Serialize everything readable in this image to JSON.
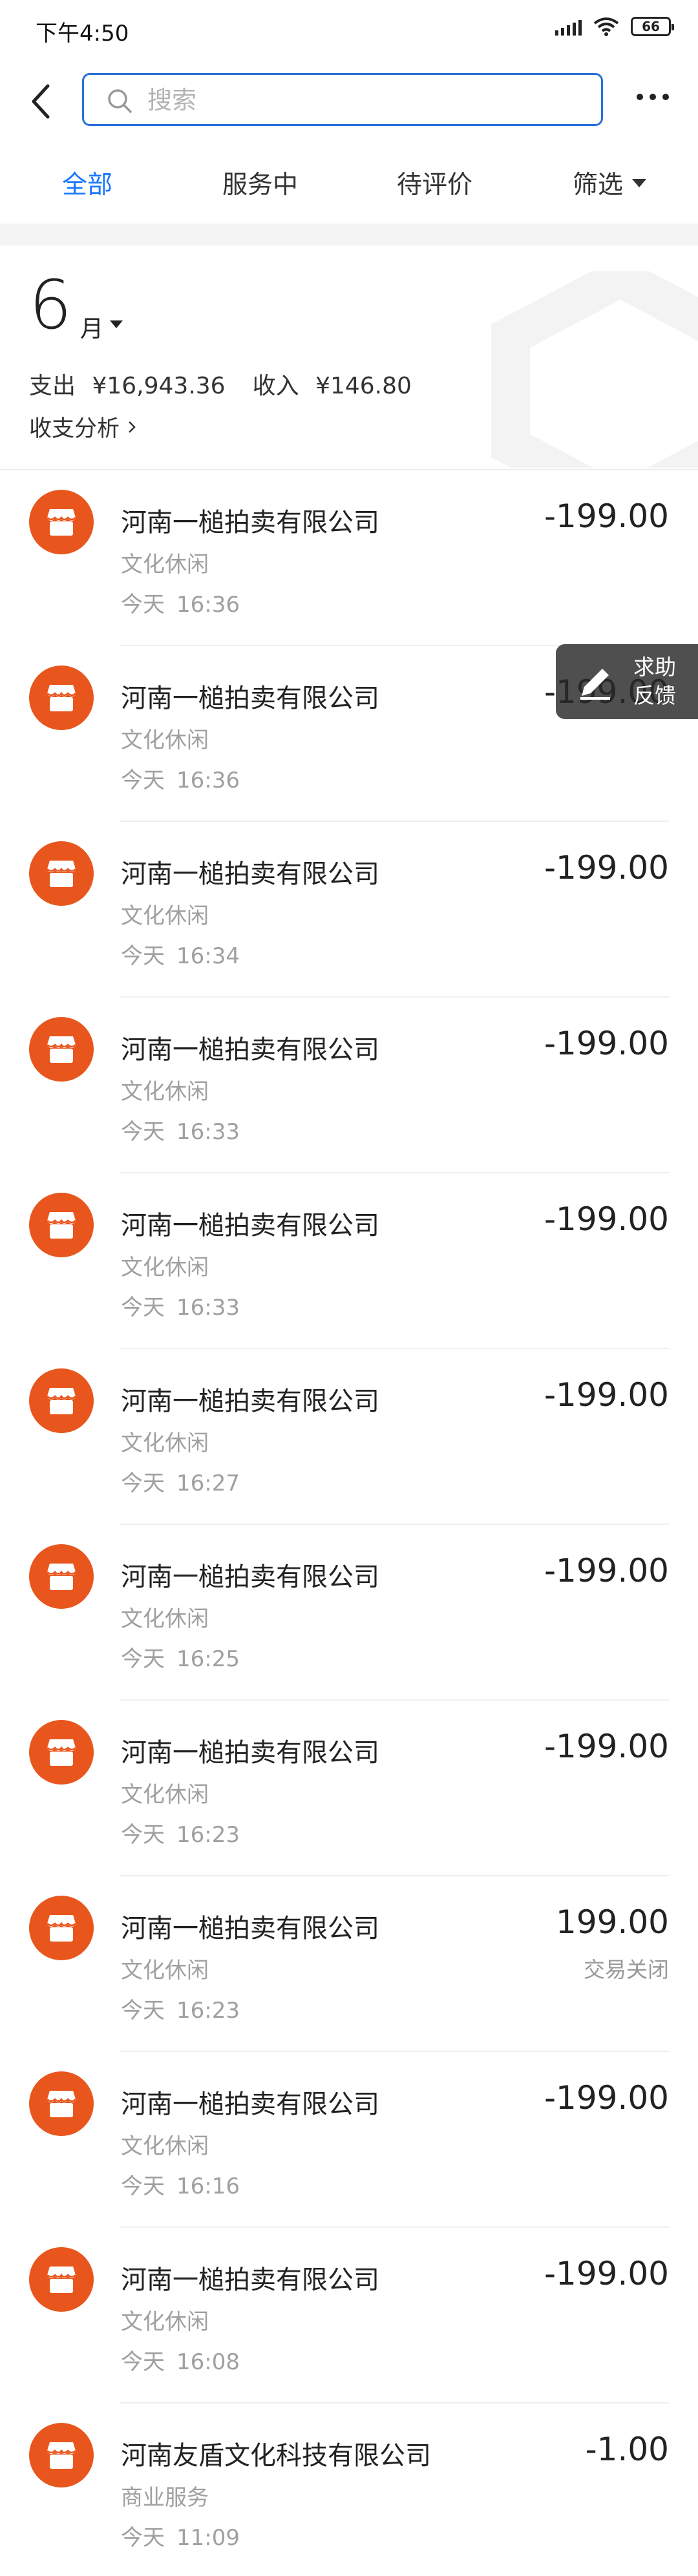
{
  "status_bar": {
    "time": "下午4:50",
    "battery": "66"
  },
  "header": {
    "search_placeholder": "搜索",
    "back_icon": "chevron-left-icon",
    "more_icon": "more-dots-icon"
  },
  "tabs": [
    {
      "label": "全部",
      "active": true
    },
    {
      "label": "服务中",
      "active": false
    },
    {
      "label": "待评价",
      "active": false
    },
    {
      "label": "筛选",
      "active": false
    }
  ],
  "summary": {
    "month": "6",
    "month_unit": "月",
    "expense_label": "支出",
    "expense": "¥16,943.36",
    "income_label": "收入",
    "income": "¥146.80",
    "analysis_label": "收支分析"
  },
  "transactions": [
    {
      "merchant": "河南一槌拍卖有限公司",
      "category": "文化休闲",
      "day": "今天",
      "time": "16:36",
      "amount": "-199.00",
      "note": ""
    },
    {
      "merchant": "河南一槌拍卖有限公司",
      "category": "文化休闲",
      "day": "今天",
      "time": "16:36",
      "amount": "-199.00",
      "note": ""
    },
    {
      "merchant": "河南一槌拍卖有限公司",
      "category": "文化休闲",
      "day": "今天",
      "time": "16:34",
      "amount": "-199.00",
      "note": ""
    },
    {
      "merchant": "河南一槌拍卖有限公司",
      "category": "文化休闲",
      "day": "今天",
      "time": "16:33",
      "amount": "-199.00",
      "note": ""
    },
    {
      "merchant": "河南一槌拍卖有限公司",
      "category": "文化休闲",
      "day": "今天",
      "time": "16:33",
      "amount": "-199.00",
      "note": ""
    },
    {
      "merchant": "河南一槌拍卖有限公司",
      "category": "文化休闲",
      "day": "今天",
      "time": "16:27",
      "amount": "-199.00",
      "note": ""
    },
    {
      "merchant": "河南一槌拍卖有限公司",
      "category": "文化休闲",
      "day": "今天",
      "time": "16:25",
      "amount": "-199.00",
      "note": ""
    },
    {
      "merchant": "河南一槌拍卖有限公司",
      "category": "文化休闲",
      "day": "今天",
      "time": "16:23",
      "amount": "-199.00",
      "note": ""
    },
    {
      "merchant": "河南一槌拍卖有限公司",
      "category": "文化休闲",
      "day": "今天",
      "time": "16:23",
      "amount": "199.00",
      "note": "交易关闭"
    },
    {
      "merchant": "河南一槌拍卖有限公司",
      "category": "文化休闲",
      "day": "今天",
      "time": "16:16",
      "amount": "-199.00",
      "note": ""
    },
    {
      "merchant": "河南一槌拍卖有限公司",
      "category": "文化休闲",
      "day": "今天",
      "time": "16:08",
      "amount": "-199.00",
      "note": ""
    },
    {
      "merchant": "河南友盾文化科技有限公司",
      "category": "商业服务",
      "day": "今天",
      "time": "11:09",
      "amount": "-1.00",
      "note": ""
    }
  ],
  "help_float": {
    "line1": "求助",
    "line2": "反馈"
  },
  "colors": {
    "accent": "#1677ff",
    "store_icon": "#e8561e"
  }
}
